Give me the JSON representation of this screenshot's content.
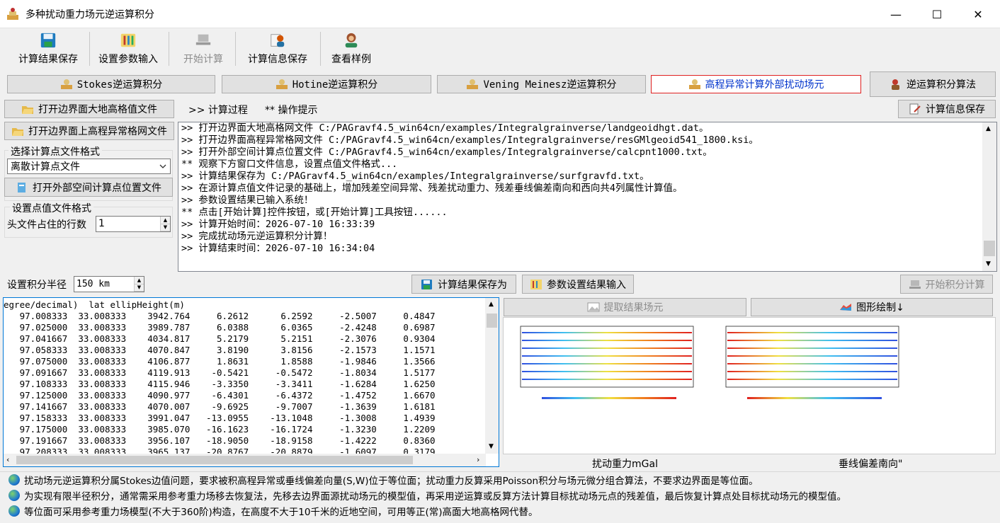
{
  "window": {
    "title": "多种扰动重力场元逆运算积分",
    "controls": [
      "—",
      "☐",
      "✕"
    ]
  },
  "toolbar": {
    "items": [
      {
        "label": "计算结果保存",
        "icon": "floppy-disk-icon",
        "enabled": true
      },
      {
        "label": "设置参数输入",
        "icon": "sliders-icon",
        "enabled": true
      },
      {
        "label": "开始计算",
        "icon": "laptop-icon",
        "enabled": false
      },
      {
        "label": "计算信息保存",
        "icon": "user-notes-icon",
        "enabled": true
      },
      {
        "label": "查看样例",
        "icon": "monkey-icon",
        "enabled": true
      }
    ]
  },
  "tabs": [
    {
      "label": "Stokes逆运算积分",
      "active": false
    },
    {
      "label": "Hotine逆运算积分",
      "active": false
    },
    {
      "label": "Vening Meinesz逆运算积分",
      "active": false
    },
    {
      "label": "高程异常计算外部扰动场元",
      "active": true
    }
  ],
  "algorithm_button": "逆运算积分算法",
  "left": {
    "open_geoid_button": "打开边界面大地高格值文件",
    "open_anomaly_button": "打开边界面上高程异常格网文件",
    "select_format_label": "选择计算点文件格式",
    "format_value": "离散计算点文件",
    "open_points_button": "打开外部空间计算点位置文件",
    "point_format_label": "设置点值文件格式",
    "header_rows_label": "头文件占住的行数",
    "header_rows_value": "1"
  },
  "log": {
    "tab_process": ">> 计算过程",
    "tab_hint": "** 操作提示",
    "save_info_button": "计算信息保存",
    "lines": [
      ">> 打开边界面大地高格网文件 C:/PAGravf4.5_win64cn/examples/Integralgrainverse/landgeoidhgt.dat。",
      ">> 打开边界面高程异常格网文件 C:/PAGravf4.5_win64cn/examples/Integralgrainverse/resGMlgeoid541_1800.ksi。",
      ">> 打开外部空间计算点位置文件 C:/PAGravf4.5_win64cn/examples/Integralgrainverse/calcpnt1000.txt。",
      " ** 观察下方窗口文件信息，设置点值文件格式...",
      ">> 计算结果保存为 C:/PAGravf4.5_win64cn/examples/Integralgrainverse/surfgravfd.txt。",
      ">> 在源计算点值文件记录的基础上，增加残差空间异常、残差扰动重力、残差垂线偏差南向和西向共4列属性计算值。",
      ">> 参数设置结果已输入系统！",
      " ** 点击[开始计算]控件按钮，或[开始计算]工具按钮......",
      ">> 计算开始时间：2026-07-10 16:33:39",
      ">> 完成扰动场元逆运算积分计算！",
      ">> 计算结束时间：2026-07-10 16:34:04"
    ]
  },
  "radius": {
    "label": "设置积分半径",
    "value": "150  km"
  },
  "actions": {
    "save_as": "计算结果保存为",
    "param_input": "参数设置结果输入",
    "start_integral": "开始积分计算",
    "extract": "提取结果场元",
    "plot": "图形绘制↓"
  },
  "data_table": {
    "header": "egree/decimal)  lat ellipHeight(m)",
    "rows": [
      [
        "97.008333",
        "33.008333",
        "3942.764",
        "6.2612",
        "6.2592",
        "-2.5007",
        "0.4847"
      ],
      [
        "97.025000",
        "33.008333",
        "3989.787",
        "6.0388",
        "6.0365",
        "-2.4248",
        "0.6987"
      ],
      [
        "97.041667",
        "33.008333",
        "4034.817",
        "5.2179",
        "5.2151",
        "-2.3076",
        "0.9304"
      ],
      [
        "97.058333",
        "33.008333",
        "4070.847",
        "3.8190",
        "3.8156",
        "-2.1573",
        "1.1571"
      ],
      [
        "97.075000",
        "33.008333",
        "4106.877",
        "1.8631",
        "1.8588",
        "-1.9846",
        "1.3566"
      ],
      [
        "97.091667",
        "33.008333",
        "4119.913",
        "-0.5421",
        "-0.5472",
        "-1.8034",
        "1.5177"
      ],
      [
        "97.108333",
        "33.008333",
        "4115.946",
        "-3.3350",
        "-3.3411",
        "-1.6284",
        "1.6250"
      ],
      [
        "97.125000",
        "33.008333",
        "4090.977",
        "-6.4301",
        "-6.4372",
        "-1.4752",
        "1.6670"
      ],
      [
        "97.141667",
        "33.008333",
        "4070.007",
        "-9.6925",
        "-9.7007",
        "-1.3639",
        "1.6181"
      ],
      [
        "97.158333",
        "33.008333",
        "3991.047",
        "-13.0955",
        "-13.1048",
        "-1.3008",
        "1.4939"
      ],
      [
        "97.175000",
        "33.008333",
        "3985.070",
        "-16.1623",
        "-16.1724",
        "-1.3230",
        "1.2209"
      ],
      [
        "97.191667",
        "33.008333",
        "3956.107",
        "-18.9050",
        "-18.9158",
        "-1.4222",
        "0.8360"
      ],
      [
        "97.208333",
        "33.008333",
        "3965.137",
        "-20.8767",
        "-20.8879",
        "-1.6097",
        "0.3179"
      ]
    ]
  },
  "plots": {
    "captions": [
      "扰动重力mGal",
      "垂线偏差南向\""
    ]
  },
  "status": {
    "lines": [
      "扰动场元逆运算积分属Stokes边值问题，要求被积高程异常或垂线偏差向量(S,W)位于等位面；扰动重力反算采用Poisson积分与场元微分组合算法，不要求边界面是等位面。",
      "为实现有限半径积分，通常需采用参考重力场移去恢复法，先移去边界面源扰动场元的模型值，再采用逆运算或反算方法计算目标扰动场元点的残差值，最后恢复计算点处目标扰动场元的模型值。",
      "等位面可采用参考重力场模型(不大于360阶)构造，在高度不大于10千米的近地空间，可用等正(常)高面大地高格网代替。"
    ]
  },
  "colors": {
    "active_tab_border": "#e02020",
    "active_tab_text": "#0033cc",
    "selection_border": "#0078d7"
  }
}
